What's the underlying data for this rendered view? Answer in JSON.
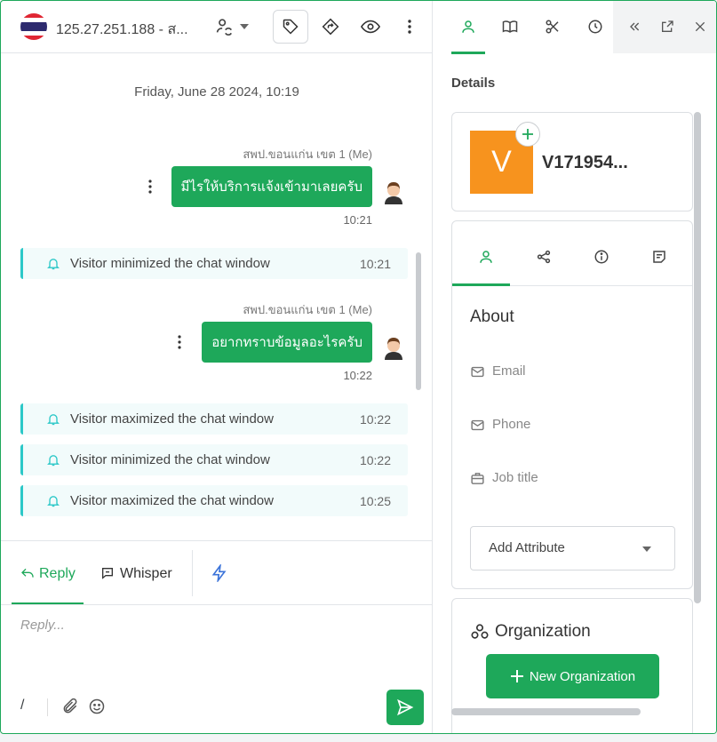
{
  "header": {
    "title": "125.27.251.188 - ส...",
    "icons": [
      "thailand-flag",
      "contact-switch-icon",
      "chevron-down-icon",
      "tag-icon",
      "forward-icon",
      "eye-icon",
      "more-vertical-icon"
    ]
  },
  "conversation": {
    "date_separator": "Friday, June 28 2024, 10:19",
    "items": [
      {
        "kind": "message",
        "sender": "สพป.ขอนแก่น เขต 1 (Me)",
        "text": "มีไรให้บริการแจ้งเข้ามาเลยครับ",
        "time": "10:21"
      },
      {
        "kind": "notice",
        "text": "Visitor minimized the chat window",
        "time": "10:21"
      },
      {
        "kind": "message",
        "sender": "สพป.ขอนแก่น เขต 1 (Me)",
        "text": "อยากทราบข้อมูลอะไรครับ",
        "time": "10:22"
      },
      {
        "kind": "notice",
        "text": "Visitor maximized the chat window",
        "time": "10:22"
      },
      {
        "kind": "notice",
        "text": "Visitor minimized the chat window",
        "time": "10:22"
      },
      {
        "kind": "notice",
        "text": "Visitor maximized the chat window",
        "time": "10:25"
      }
    ]
  },
  "composer": {
    "tabs": {
      "reply": "Reply",
      "whisper": "Whisper"
    },
    "placeholder": "Reply...",
    "shortcut": "/"
  },
  "sidebar": {
    "details_title": "Details",
    "contact": {
      "initial": "V",
      "name": "V171954..."
    },
    "about": {
      "title": "About",
      "fields": [
        "Email",
        "Phone",
        "Job title"
      ],
      "add_attribute": "Add Attribute"
    },
    "organization": {
      "title": "Organization",
      "button": "New Organization"
    }
  },
  "colors": {
    "brand_green": "#1ea85a",
    "notice_accent": "#2cc8c8",
    "avatar_orange": "#f7931e"
  }
}
